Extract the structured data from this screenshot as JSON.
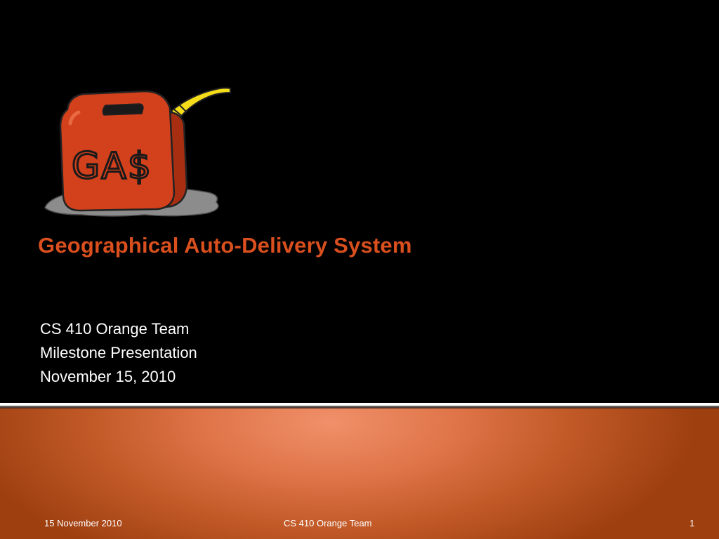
{
  "slide": {
    "logo_text": "GA$",
    "title": "Geographical Auto-Delivery System",
    "subtitle_lines": [
      "CS 410 Orange Team",
      "Milestone Presentation",
      "November 15, 2010"
    ],
    "footer": {
      "date": "15 November 2010",
      "team": "CS 410 Orange Team",
      "page_number": "1"
    }
  },
  "colors": {
    "background_top": "#000000",
    "title_color": "#d94f1e",
    "text_color": "#ffffff",
    "gas_can_red": "#d2401c",
    "nozzle_yellow": "#f5dd1a",
    "puddle_gray": "#8a8a8a",
    "bottom_gradient_light": "#f0906a",
    "bottom_gradient_dark": "#9e3f10"
  },
  "icons": {
    "logo": "gas-can-icon"
  }
}
